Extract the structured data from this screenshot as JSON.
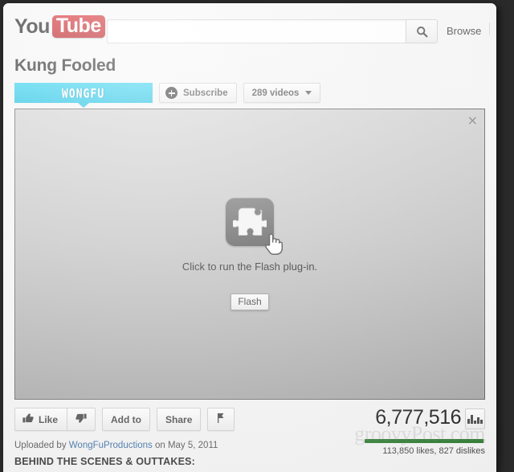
{
  "header": {
    "logo_you": "You",
    "logo_tube": "Tube",
    "search_value": "",
    "search_placeholder": "",
    "search_icon": "search-icon",
    "browse_label": "Browse"
  },
  "video": {
    "title": "Kung Fooled",
    "channel_banner_text": "WONGFU",
    "subscribe_label": "Subscribe",
    "videos_label": "289 videos",
    "close_label": "×"
  },
  "player": {
    "plugin_message": "Click to run the Flash plug-in.",
    "plugin_icon": "puzzle-piece-icon",
    "cursor_icon": "hand-cursor-icon",
    "flash_tooltip": "Flash"
  },
  "actions": {
    "like_label": "Like",
    "like_icon": "thumbs-up-icon",
    "dislike_icon": "thumbs-down-icon",
    "add_to_label": "Add to",
    "share_label": "Share",
    "flag_icon": "flag-icon",
    "stats_icon": "bar-chart-icon"
  },
  "stats": {
    "view_count": "6,777,516",
    "likes_dislikes": "113,850 likes, 827 dislikes"
  },
  "meta": {
    "uploaded_prefix": "Uploaded by",
    "uploader": "WongFuProductions",
    "uploaded_suffix": "on May 5, 2011",
    "description_line": "BEHIND THE SCENES & OUTTAKES:"
  },
  "watermark": {
    "text": "groovyPost.com"
  },
  "colors": {
    "youtube_red": "#cc181e",
    "channel_cyan": "#25c7e8",
    "like_bar_green": "#2f7d32",
    "link_blue": "#3a6ea5"
  }
}
